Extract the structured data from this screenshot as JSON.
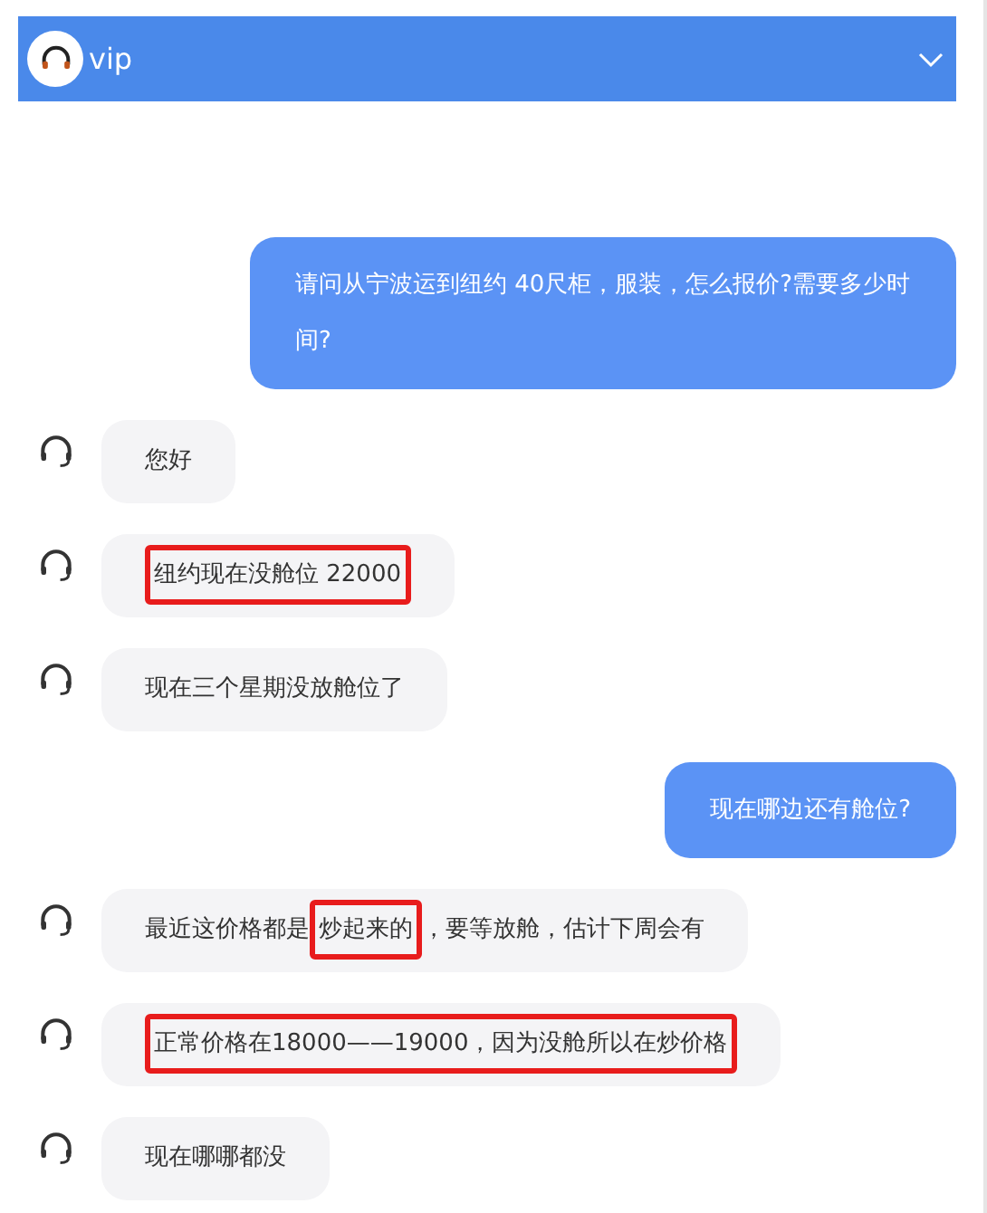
{
  "header": {
    "title": "vip"
  },
  "messages": [
    {
      "kind": "user",
      "segments": [
        {
          "text": "请问从宁波运到纽约 40尺柜，服装，怎么报价?需要多少时间?",
          "highlighted": false
        }
      ]
    },
    {
      "kind": "agent",
      "segments": [
        {
          "text": "您好",
          "highlighted": false
        }
      ]
    },
    {
      "kind": "agent",
      "segments": [
        {
          "text": "纽约现在没舱位 22000",
          "highlighted": true
        }
      ]
    },
    {
      "kind": "agent",
      "segments": [
        {
          "text": "现在三个星期没放舱位了",
          "highlighted": false
        }
      ]
    },
    {
      "kind": "user",
      "segments": [
        {
          "text": "现在哪边还有舱位?",
          "highlighted": false
        }
      ]
    },
    {
      "kind": "agent",
      "segments": [
        {
          "text": "最近这价格都是",
          "highlighted": false
        },
        {
          "text": "炒起来的",
          "highlighted": true
        },
        {
          "text": "，要等放舱，估计下周会有",
          "highlighted": false
        }
      ]
    },
    {
      "kind": "agent",
      "segments": [
        {
          "text": "正常价格在18000——19000，因为没舱所以在炒价格",
          "highlighted": true
        }
      ]
    },
    {
      "kind": "agent",
      "segments": [
        {
          "text": "现在哪哪都没",
          "highlighted": false
        }
      ]
    }
  ]
}
